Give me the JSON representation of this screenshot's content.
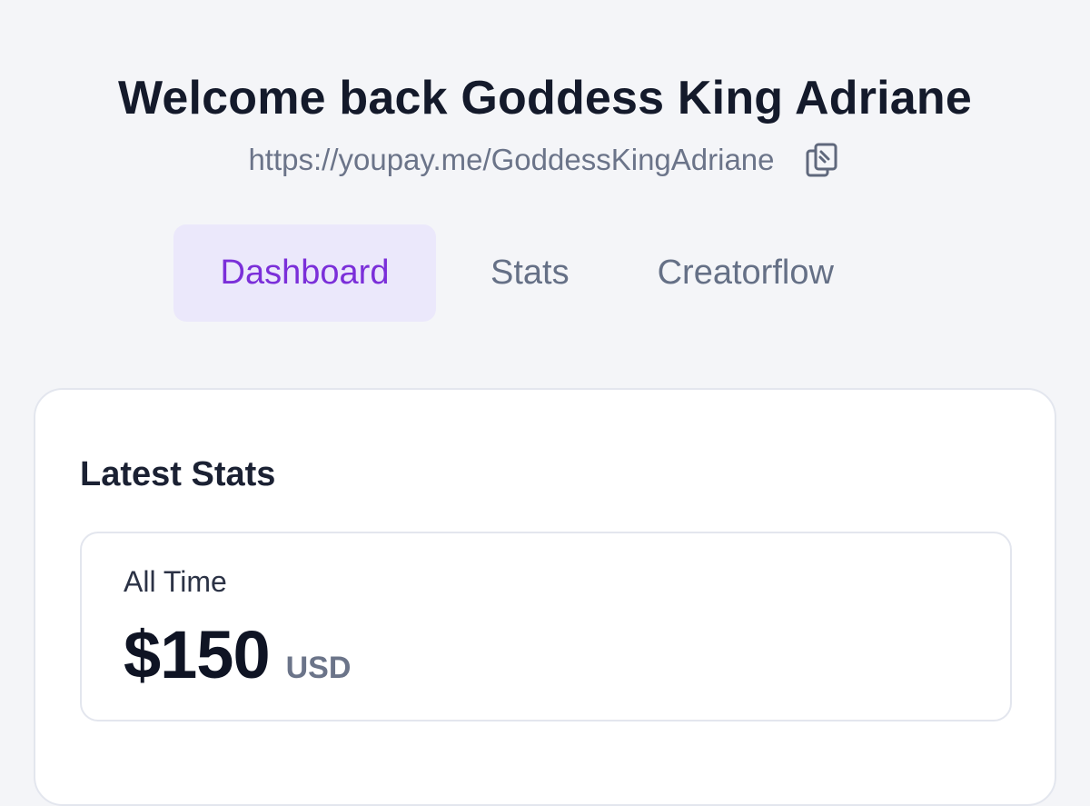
{
  "header": {
    "welcome_text": "Welcome back Goddess King Adriane",
    "profile_url": "https://youpay.me/GoddessKingAdriane",
    "copy_icon": "clipboard-icon"
  },
  "tabs": [
    {
      "label": "Dashboard",
      "active": true
    },
    {
      "label": "Stats",
      "active": false
    },
    {
      "label": "Creatorflow",
      "active": false
    }
  ],
  "latest_stats": {
    "title": "Latest Stats",
    "all_time": {
      "label": "All Time",
      "amount": "$150",
      "currency": "USD"
    }
  },
  "colors": {
    "accent": "#7b2fd9",
    "active_tab_bg": "#ebe8fb",
    "page_bg": "#f4f5f8",
    "muted_text": "#6b7489"
  }
}
